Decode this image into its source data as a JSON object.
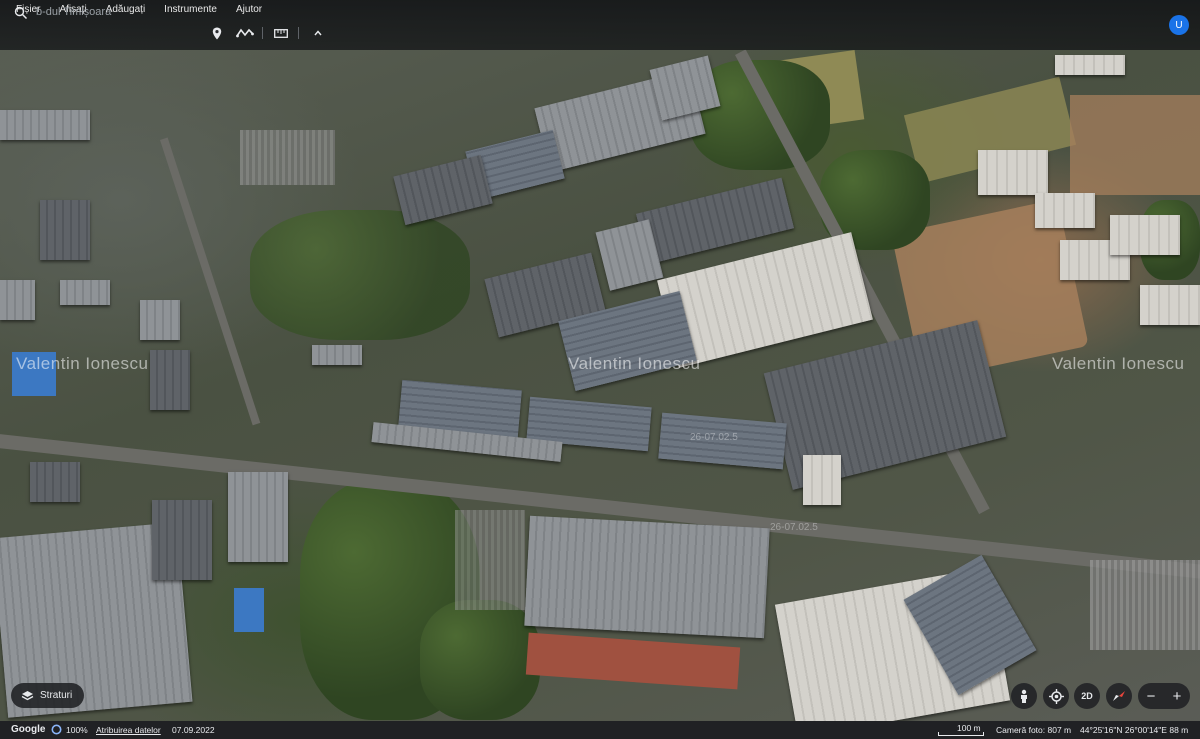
{
  "menu": {
    "items": [
      "Fișier",
      "Afișați",
      "Adăugați",
      "Instrumente",
      "Ajutor"
    ]
  },
  "search": {
    "value": "b-dul Timișoara",
    "placeholder": "b-dul Timișoara"
  },
  "toolbar": {
    "icons": [
      "search-icon",
      "placemark-icon",
      "path-icon",
      "ruler-icon",
      "chevron-up-icon"
    ]
  },
  "account": {
    "initial": "U",
    "color": "#1a73e8"
  },
  "map": {
    "watermarks": [
      "Valentin Ionescu",
      "Valentin Ionescu",
      "Valentin Ionescu"
    ],
    "small_watermarks": [
      "26-07.02.5",
      "26-07.02.5"
    ]
  },
  "controls": {
    "layers_label": "Straturi",
    "view_mode_label": "2D",
    "zoom_in": "+",
    "zoom_out": "−"
  },
  "status": {
    "google": "Google",
    "zoom_percent": "100%",
    "attribution": "Atribuirea datelor",
    "date": "07.09.2022",
    "scale": "100 m",
    "camera": "Cameră foto: 807 m",
    "coordinates": "44°25'16\"N 26°00'14\"E 88 m"
  }
}
